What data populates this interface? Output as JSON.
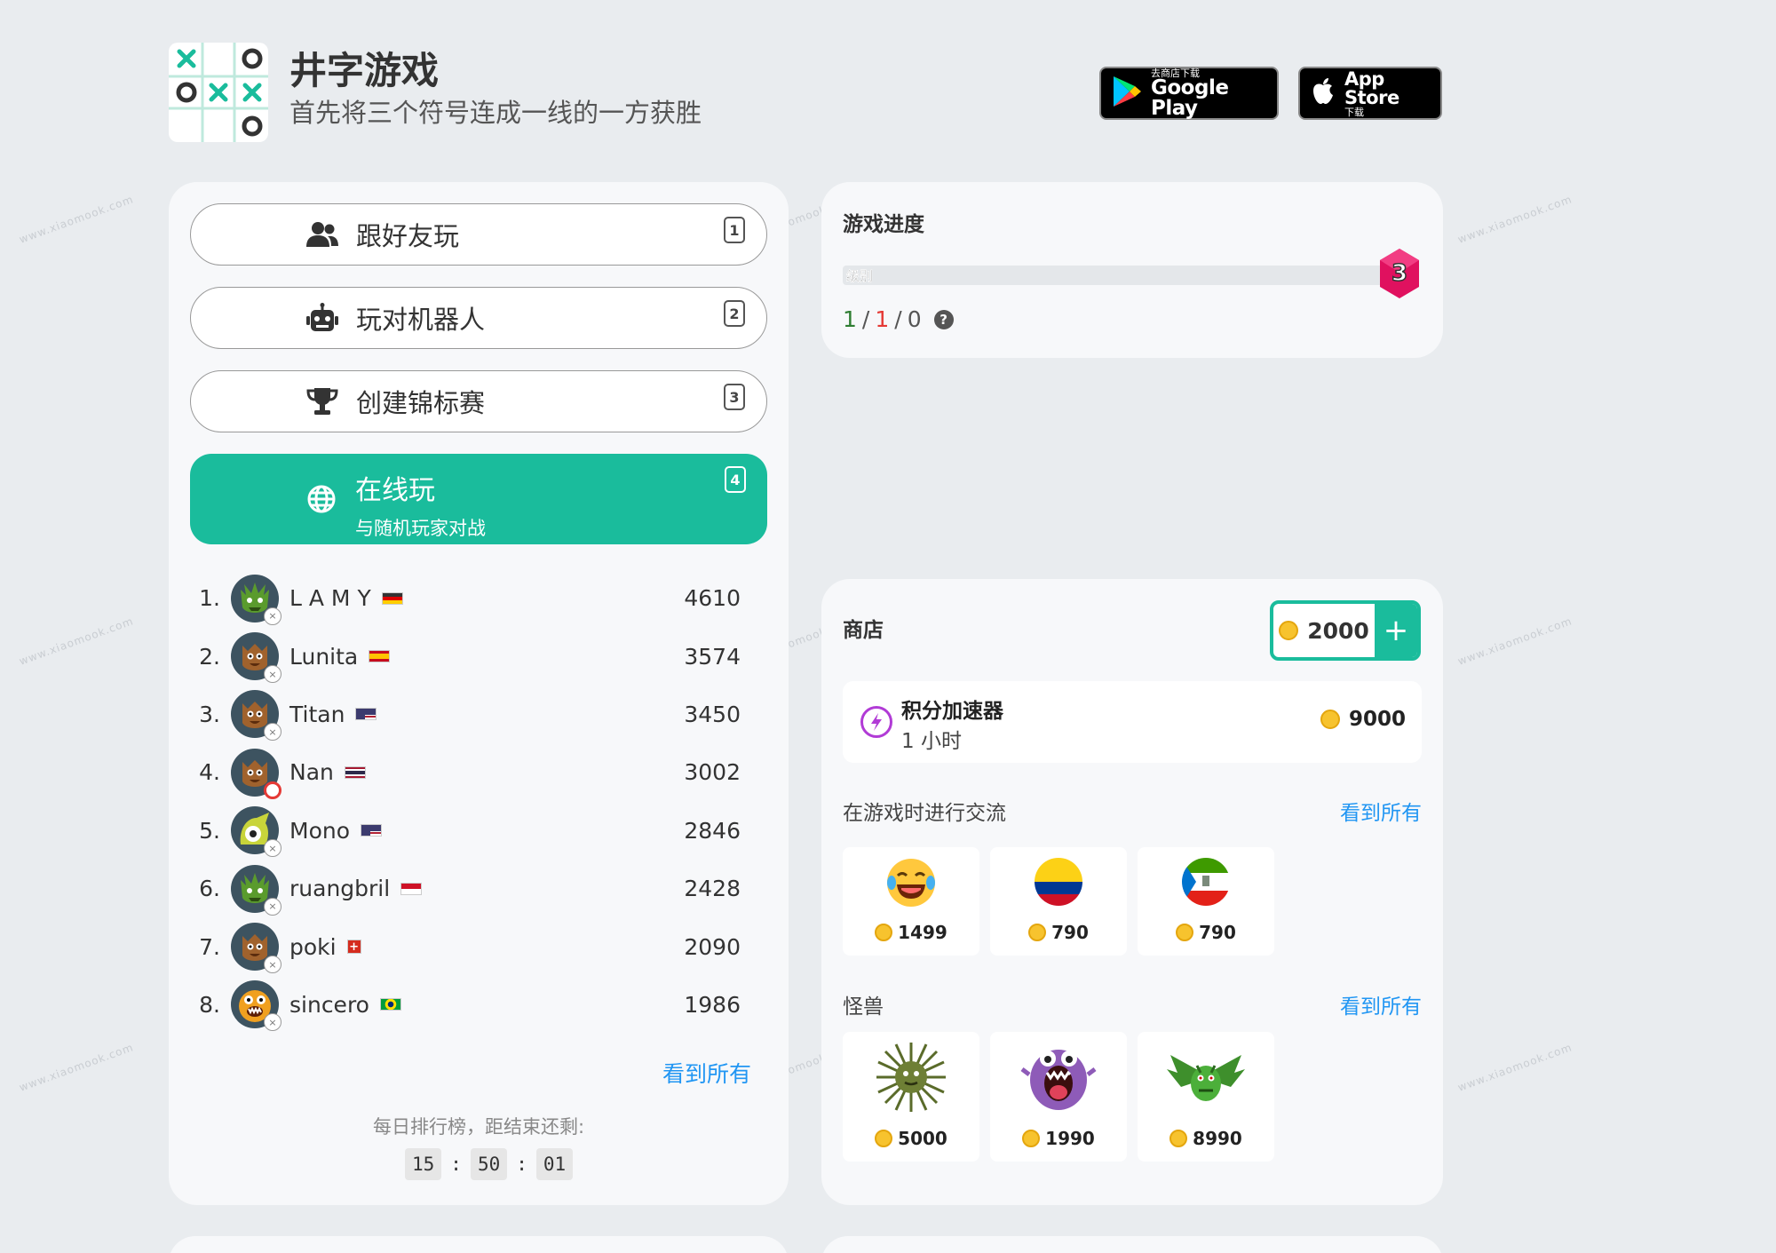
{
  "header": {
    "title": "井字游戏",
    "subtitle": "首先将三个符号连成一线的一方获胜",
    "google_play": {
      "small": "去商店下载",
      "big": "Google Play"
    },
    "app_store": {
      "big": "App Store",
      "small": "下载"
    }
  },
  "modes": [
    {
      "label": "跟好友玩",
      "key": "1",
      "icon": "friends-icon"
    },
    {
      "label": "玩对机器人",
      "key": "2",
      "icon": "robot-icon"
    },
    {
      "label": "创建锦标赛",
      "key": "3",
      "icon": "trophy-icon"
    },
    {
      "label": "在线玩",
      "sublabel": "与随机玩家对战",
      "key": "4",
      "icon": "globe-icon"
    }
  ],
  "leaderboard": {
    "rows": [
      {
        "rank": "1.",
        "name": "L A M Y",
        "score": "4610",
        "flag": "germany"
      },
      {
        "rank": "2.",
        "name": "Lunita",
        "score": "3574",
        "flag": "spain"
      },
      {
        "rank": "3.",
        "name": "Titan",
        "score": "3450",
        "flag": "usa"
      },
      {
        "rank": "4.",
        "name": "Nan",
        "score": "3002",
        "flag": "thailand"
      },
      {
        "rank": "5.",
        "name": "Mono",
        "score": "2846",
        "flag": "usa"
      },
      {
        "rank": "6.",
        "name": "ruangbril",
        "score": "2428",
        "flag": "indonesia"
      },
      {
        "rank": "7.",
        "name": "poki",
        "score": "2090",
        "flag": "switzerland"
      },
      {
        "rank": "8.",
        "name": "sincero",
        "score": "1986",
        "flag": "brazil"
      }
    ],
    "see_all": "看到所有",
    "daily_label": "每日排行榜，距结束还剩:",
    "timer": {
      "h": "15",
      "sep": ":",
      "m": "50",
      "s": "01"
    }
  },
  "progress": {
    "title": "游戏进度",
    "level_label": "级别",
    "level": "3",
    "level_fill": 0.0,
    "wins": "1",
    "losses": "1",
    "draws": "0",
    "sep": "/",
    "help": "?"
  },
  "shop": {
    "title": "商店",
    "coins": "2000",
    "plus": "+",
    "booster": {
      "name": "积分加速器",
      "duration": "1 小时",
      "price": "9000"
    },
    "chat_section": {
      "title": "在游戏时进行交流",
      "see_all": "看到所有",
      "items": [
        {
          "icon": "laughing-emoji-icon",
          "price": "1499"
        },
        {
          "icon": "colombia-flag-icon",
          "price": "790"
        },
        {
          "icon": "equatorial-guinea-flag-icon",
          "price": "790"
        }
      ]
    },
    "monster_section": {
      "title": "怪兽",
      "see_all": "看到所有",
      "items": [
        {
          "icon": "spiky-green-monster-icon",
          "price": "5000"
        },
        {
          "icon": "purple-monster-icon",
          "price": "1990"
        },
        {
          "icon": "green-dragon-icon",
          "price": "8990"
        }
      ]
    }
  },
  "colors": {
    "accent": "#1abc9c",
    "link": "#2196f3",
    "win": "#2e7d32",
    "loss": "#e53935",
    "background": "#e9ecef"
  }
}
